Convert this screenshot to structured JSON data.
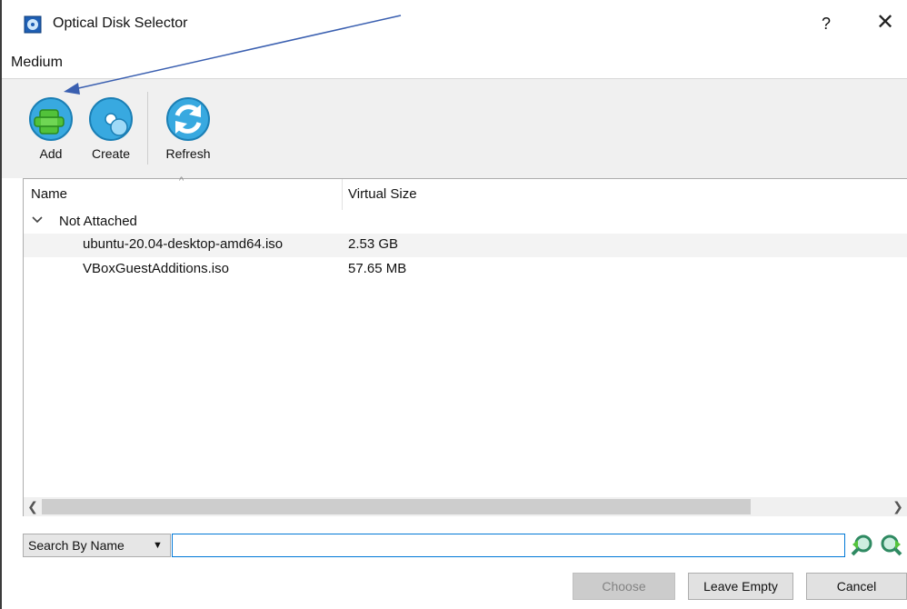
{
  "window": {
    "title": "Optical Disk Selector",
    "help_glyph": "?",
    "close_glyph": "✕"
  },
  "menu": {
    "items": [
      {
        "label": "Medium"
      }
    ]
  },
  "toolbar": {
    "buttons": [
      {
        "label": "Add",
        "icon": "add-disk-icon"
      },
      {
        "label": "Create",
        "icon": "create-disk-icon"
      },
      {
        "label": "Refresh",
        "icon": "refresh-icon"
      }
    ]
  },
  "tree": {
    "columns": [
      "Name",
      "Virtual Size"
    ],
    "sort_indicator": "^",
    "groups": [
      {
        "label": "Not Attached",
        "expanded": true,
        "rows": [
          {
            "name": "ubuntu-20.04-desktop-amd64.iso",
            "size": "2.53 GB"
          },
          {
            "name": "VBoxGuestAdditions.iso",
            "size": "57.65 MB"
          }
        ]
      }
    ]
  },
  "search": {
    "mode": "Search By Name",
    "value": "",
    "placeholder": ""
  },
  "buttons": {
    "choose": "Choose",
    "leave_empty": "Leave Empty",
    "cancel": "Cancel"
  },
  "colors": {
    "accent": "#0078d7",
    "annotation_arrow": "#3a5fb0",
    "toolbar_bg": "#f0f0f0",
    "icon_blue": "#2f9fd8",
    "icon_green": "#55c43c"
  }
}
